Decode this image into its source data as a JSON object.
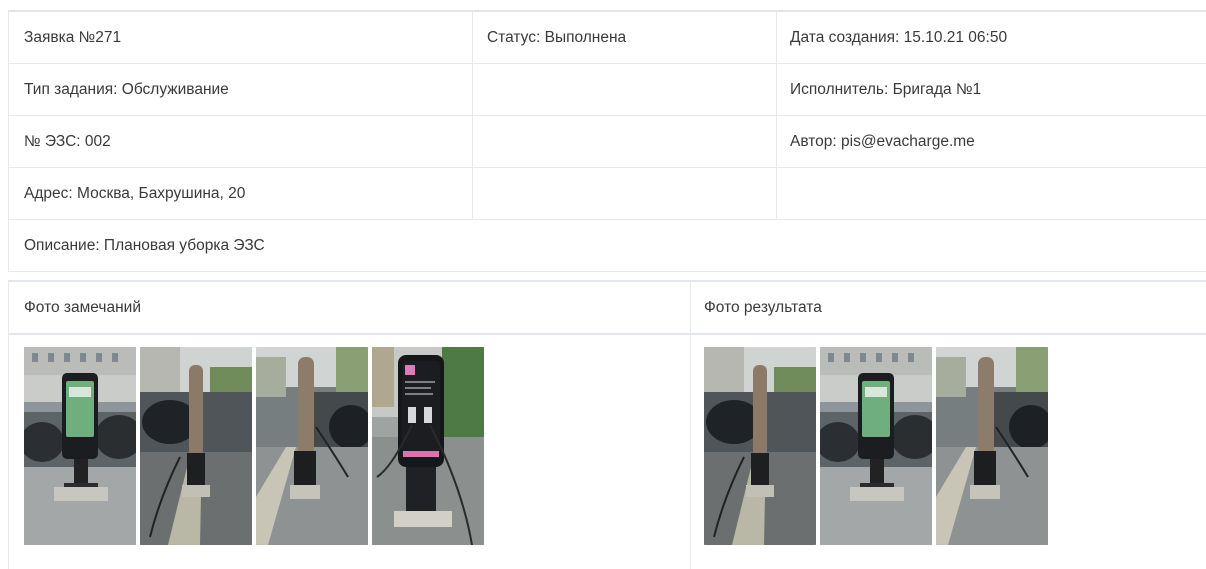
{
  "order": {
    "number": "Заявка №271",
    "status": "Статус: Выполнена",
    "created": "Дата создания: 15.10.21 06:50",
    "task_type": "Тип задания: Обслуживание",
    "executor": "Исполнитель: Бригада №1",
    "station": "№ ЭЗС: 002",
    "author": "Автор: pis@evacharge.me",
    "address": "Адрес: Москва, Бахрушина, 20",
    "description": "Описание: Плановая уборка ЭЗС"
  },
  "photos": {
    "issues_header": "Фото замечаний",
    "result_header": "Фото результата",
    "issues": [
      {
        "name": "photo-issue-1",
        "subject": "charging-station-front"
      },
      {
        "name": "photo-issue-2",
        "subject": "charging-post-side"
      },
      {
        "name": "photo-issue-3",
        "subject": "charging-post-rear"
      },
      {
        "name": "photo-issue-4",
        "subject": "charging-station-closeup"
      }
    ],
    "results": [
      {
        "name": "photo-result-1",
        "subject": "charging-post-side"
      },
      {
        "name": "photo-result-2",
        "subject": "charging-station-front"
      },
      {
        "name": "photo-result-3",
        "subject": "charging-post-rear"
      }
    ]
  },
  "colors": {
    "border": "#e6e9ee",
    "header_border": "#e2e6ec",
    "text": "#3a3a3a"
  }
}
